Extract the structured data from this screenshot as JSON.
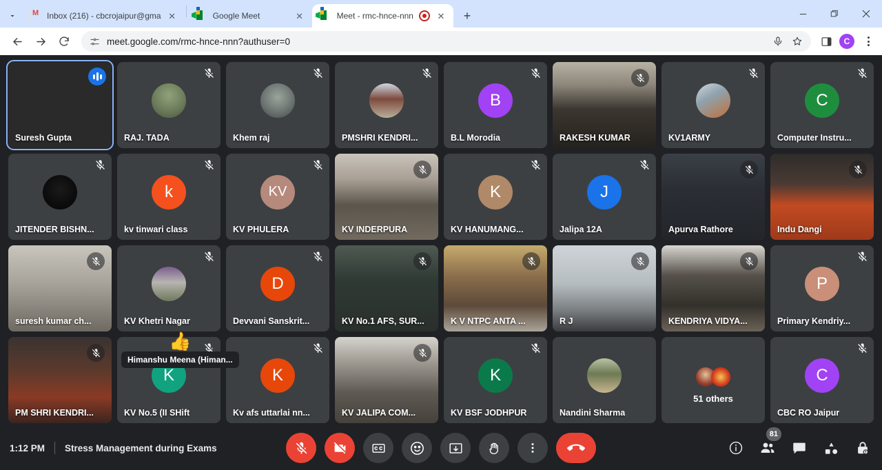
{
  "browser": {
    "tabs": [
      {
        "title": "Inbox (216) - cbcrojaipur@gma",
        "favicon": "gmail-icon",
        "active": false,
        "recording": false
      },
      {
        "title": "Google Meet",
        "favicon": "meet-icon",
        "active": false,
        "recording": false
      },
      {
        "title": "Meet - rmc-hnce-nnn",
        "favicon": "meet-icon",
        "active": true,
        "recording": true
      }
    ],
    "new_tab_label": "+",
    "tab_list_chevron": "chevron-down-icon",
    "window_controls": {
      "minimize": "minimize-icon",
      "maximize": "maximize-icon",
      "close": "close-icon"
    },
    "nav": {
      "back": "back-arrow-icon",
      "forward": "forward-arrow-icon",
      "reload": "reload-icon"
    },
    "omnibox": {
      "site_settings_icon": "site-settings-icon",
      "url": "meet.google.com/rmc-hnce-nnn?authuser=0",
      "mic_icon": "microphone-icon",
      "bookmark_icon": "star-icon"
    },
    "side_panel_icon": "side-panel-icon",
    "profile_initial": "C",
    "menu_icon": "three-dot-menu-icon"
  },
  "meeting": {
    "time": "1:12 PM",
    "title": "Stress Management during Exams",
    "reaction": {
      "emoji": "👍",
      "label": "Himanshu Meena (Himan..."
    },
    "controls": [
      {
        "name": "microphone-off-button",
        "icon": "mic-off-icon",
        "state": "muted"
      },
      {
        "name": "camera-off-button",
        "icon": "camera-off-icon",
        "state": "off"
      },
      {
        "name": "captions-button",
        "icon": "closed-captions-icon",
        "state": "default"
      },
      {
        "name": "reactions-button",
        "icon": "emoji-smile-icon",
        "state": "default"
      },
      {
        "name": "present-screen-button",
        "icon": "present-screen-icon",
        "state": "default"
      },
      {
        "name": "raise-hand-button",
        "icon": "raised-hand-icon",
        "state": "default"
      },
      {
        "name": "more-options-button",
        "icon": "three-dot-menu-icon",
        "state": "default"
      },
      {
        "name": "leave-call-button",
        "icon": "end-call-icon",
        "state": "danger"
      }
    ],
    "right_controls": [
      {
        "name": "meeting-details-button",
        "icon": "info-icon",
        "badge": null
      },
      {
        "name": "participants-button",
        "icon": "people-icon",
        "badge": "81"
      },
      {
        "name": "chat-button",
        "icon": "chat-bubble-icon",
        "badge": null
      },
      {
        "name": "activities-button",
        "icon": "activities-shapes-icon",
        "badge": null
      },
      {
        "name": "host-controls-button",
        "icon": "lock-icon",
        "badge": null
      }
    ]
  },
  "participants": [
    {
      "name": "Suresh Gupta",
      "kind": "video",
      "muted": false,
      "selected": true,
      "speaking": true,
      "video": "indoor-room-man"
    },
    {
      "name": "RAJ. TADA",
      "kind": "photo",
      "muted": true,
      "photo": "outdoor-portrait"
    },
    {
      "name": "Khem raj",
      "kind": "photo",
      "muted": true,
      "photo": "man-standing"
    },
    {
      "name": "PMSHRI KENDRI...",
      "kind": "photo",
      "muted": true,
      "photo": "school-assembly"
    },
    {
      "name": "B.L Morodia",
      "kind": "letter",
      "muted": true,
      "initial": "B",
      "color": "#a142f4"
    },
    {
      "name": "RAKESH KUMAR",
      "kind": "video",
      "muted": true,
      "video": "classroom-crowd-dark"
    },
    {
      "name": "KV1ARMY",
      "kind": "photo",
      "muted": true,
      "photo": "classroom-pale"
    },
    {
      "name": "Computer Instru...",
      "kind": "letter",
      "muted": true,
      "initial": "C",
      "color": "#1e8e3e"
    },
    {
      "name": "JITENDER BISHN...",
      "kind": "photo",
      "muted": true,
      "photo": "dark-night-photo"
    },
    {
      "name": "kv tinwari class",
      "kind": "letter",
      "muted": true,
      "initial": "k",
      "color": "#f4511e"
    },
    {
      "name": "KV PHULERA",
      "kind": "letter",
      "muted": true,
      "initial": "KV",
      "color": "#b5897c"
    },
    {
      "name": "KV INDERPURA",
      "kind": "video",
      "muted": true,
      "video": "hall-students-seated"
    },
    {
      "name": "KV HANUMANG...",
      "kind": "letter",
      "muted": true,
      "initial": "K",
      "color": "#b08968"
    },
    {
      "name": "Jalipa 12A",
      "kind": "letter",
      "muted": true,
      "initial": "J",
      "color": "#1a73e8"
    },
    {
      "name": "Apurva Rathore",
      "kind": "video",
      "muted": true,
      "video": "students-audience"
    },
    {
      "name": "Indu Dangi",
      "kind": "video",
      "muted": true,
      "video": "orange-carpet-hall"
    },
    {
      "name": "suresh kumar ch...",
      "kind": "video",
      "muted": true,
      "video": "room-white-wall"
    },
    {
      "name": "KV Khetri Nagar",
      "kind": "photo",
      "muted": true,
      "photo": "school-building"
    },
    {
      "name": "Devvani Sanskrit...",
      "kind": "letter",
      "muted": true,
      "initial": "D",
      "color": "#e8470a"
    },
    {
      "name": "KV No.1 AFS, SUR...",
      "kind": "video",
      "muted": true,
      "video": "students-green-uniform"
    },
    {
      "name": "K V NTPC ANTA ...",
      "kind": "video",
      "muted": true,
      "video": "corridor-students"
    },
    {
      "name": "R J",
      "kind": "video",
      "muted": true,
      "video": "hall-ceiling"
    },
    {
      "name": "KENDRIYA VIDYA...",
      "kind": "video",
      "muted": true,
      "video": "auditorium-desks"
    },
    {
      "name": "Primary Kendriy...",
      "kind": "letter",
      "muted": true,
      "initial": "P",
      "color": "#c98f78"
    },
    {
      "name": "PM SHRI KENDRI...",
      "kind": "video",
      "muted": true,
      "video": "dark-hall-red"
    },
    {
      "name": "KV No.5 (II SHift",
      "kind": "letter",
      "muted": true,
      "initial": "K",
      "color": "#11a37f"
    },
    {
      "name": "Kv afs uttarlai nn...",
      "kind": "letter",
      "muted": true,
      "initial": "K",
      "color": "#e8470a"
    },
    {
      "name": "KV JALIPA COM...",
      "kind": "video",
      "muted": true,
      "video": "crowded-hall-bright"
    },
    {
      "name": "KV BSF JODHPUR",
      "kind": "letter",
      "muted": true,
      "initial": "K",
      "color": "#0b7a4b"
    },
    {
      "name": "Nandini Sharma",
      "kind": "photo",
      "muted": false,
      "photo": "person-on-stage"
    },
    {
      "name": "51 others",
      "kind": "others",
      "muted": false
    },
    {
      "name": "CBC RO Jaipur",
      "kind": "letter",
      "muted": true,
      "initial": "C",
      "color": "#a142f4"
    }
  ]
}
